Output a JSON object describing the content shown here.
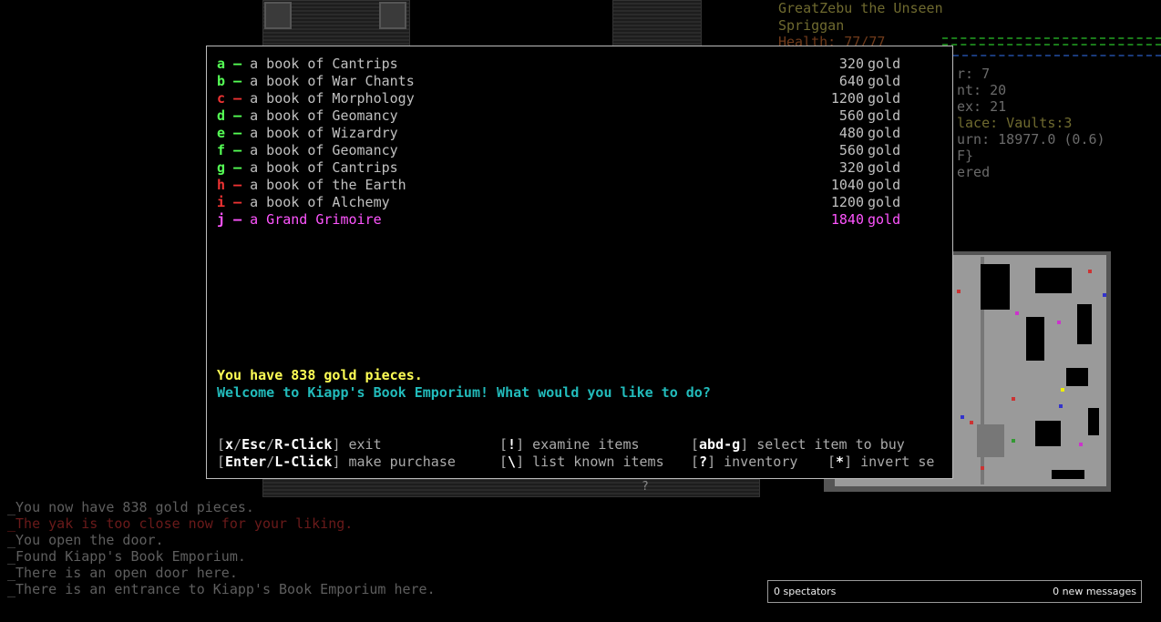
{
  "colors": {
    "green": "#55ff55",
    "red": "#ee3333",
    "magenta": "#ff55ff",
    "yellow": "#ffff55",
    "cyan": "#22bbbb",
    "item": "#c0c0c0",
    "olive": "#6f6a2f"
  },
  "player": {
    "name": "GreatZebu the Unseen",
    "species": "Spriggan",
    "health": "Health: 77/77",
    "str": "r: 7",
    "int": "nt: 20",
    "dex": "ex: 21",
    "place": "lace: Vaults:3",
    "turn": "urn: 18977.0 (0.6)",
    "misc1": "F}",
    "misc2": "ered"
  },
  "shop": {
    "items": [
      {
        "key": "a",
        "sep": "–",
        "name": "a book of Cantrips",
        "price": "320",
        "unit": "gold",
        "color": "green"
      },
      {
        "key": "b",
        "sep": "–",
        "name": "a book of War Chants",
        "price": "640",
        "unit": "gold",
        "color": "green"
      },
      {
        "key": "c",
        "sep": "–",
        "name": "a book of Morphology",
        "price": "1200",
        "unit": "gold",
        "color": "red"
      },
      {
        "key": "d",
        "sep": "–",
        "name": "a book of Geomancy",
        "price": "560",
        "unit": "gold",
        "color": "green"
      },
      {
        "key": "e",
        "sep": "–",
        "name": "a book of Wizardry",
        "price": "480",
        "unit": "gold",
        "color": "green"
      },
      {
        "key": "f",
        "sep": "–",
        "name": "a book of Geomancy",
        "price": "560",
        "unit": "gold",
        "color": "green"
      },
      {
        "key": "g",
        "sep": "–",
        "name": "a book of Cantrips",
        "price": "320",
        "unit": "gold",
        "color": "green"
      },
      {
        "key": "h",
        "sep": "–",
        "name": "a book of the Earth",
        "price": "1040",
        "unit": "gold",
        "color": "red"
      },
      {
        "key": "i",
        "sep": "–",
        "name": "a book of Alchemy",
        "price": "1200",
        "unit": "gold",
        "color": "red"
      },
      {
        "key": "j",
        "sep": "–",
        "name": "a Grand Grimoire",
        "price": "1840",
        "unit": "gold",
        "color": "magenta"
      }
    ],
    "gold_line": "You have 838 gold pieces.",
    "welcome_line": "Welcome to Kiapp's Book Emporium! What would you like to do?",
    "help": {
      "exit_keys": [
        "x",
        "Esc",
        "R-Click"
      ],
      "exit_label": "exit",
      "examine_key": "!",
      "examine_label": "examine items",
      "select_key": "abd-g",
      "select_label": "select item to buy",
      "purchase_keys": [
        "Enter",
        "L-Click"
      ],
      "purchase_label": "make purchase",
      "list_key": "\\",
      "list_label": "list known items",
      "inventory_key": "?",
      "inventory_label": "inventory",
      "invert_key": "*",
      "invert_label": "invert se"
    }
  },
  "messages": [
    {
      "text": "_You now have 838 gold pieces.",
      "color": "#5e5e5e"
    },
    {
      "text": "_The yak is too close now for your liking.",
      "color": "#6a1a1a"
    },
    {
      "text": "_You open the door.",
      "color": "#5e5e5e"
    },
    {
      "text": "_Found Kiapp's Book Emporium.",
      "color": "#5e5e5e"
    },
    {
      "text": "_There is an open door here.",
      "color": "#5e5e5e"
    },
    {
      "text": "_There is an entrance to Kiapp's Book Emporium here.",
      "color": "#5e5e5e"
    }
  ],
  "status": {
    "spectators": "0 spectators",
    "new_messages": "0 new messages"
  },
  "map_glyph": "?"
}
